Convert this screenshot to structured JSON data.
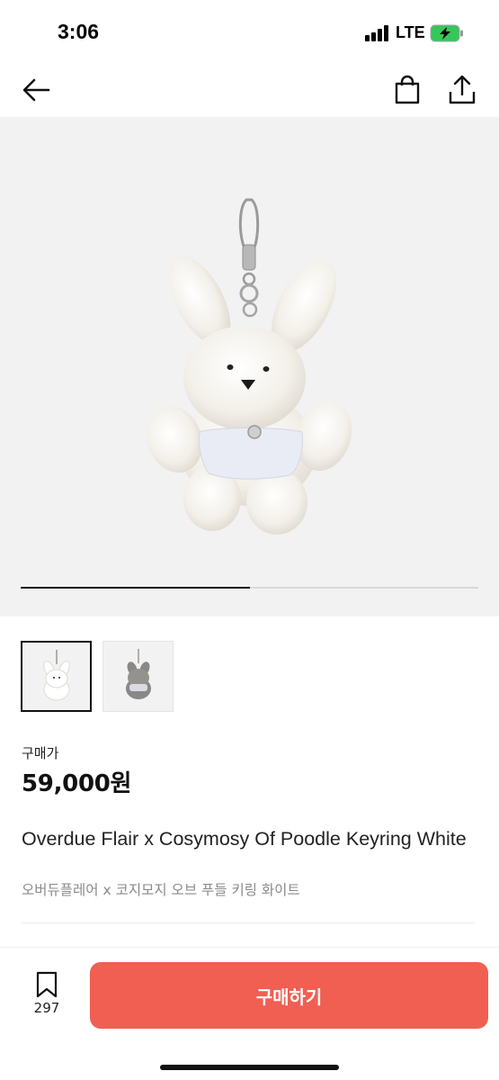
{
  "status_bar": {
    "time": "3:06",
    "network": "LTE"
  },
  "nav": {
    "icons": [
      "back-arrow-icon",
      "shopping-bag-icon",
      "share-icon"
    ]
  },
  "gallery": {
    "progress": 0.5,
    "thumbnails": [
      {
        "variant": "white",
        "selected": true
      },
      {
        "variant": "gray",
        "selected": false
      }
    ]
  },
  "product": {
    "price_label": "구매가",
    "price": "59,000원",
    "name_en": "Overdue Flair x Cosymosy Of Poodle Keyring White",
    "name_ko": "오버듀플레어 x 코지모지 오브 푸들 키링 화이트"
  },
  "bottom_bar": {
    "wish_count": "297",
    "buy_label": "구매하기"
  },
  "colors": {
    "buy_button": "#f05f52",
    "image_background": "#f2f2f2"
  }
}
